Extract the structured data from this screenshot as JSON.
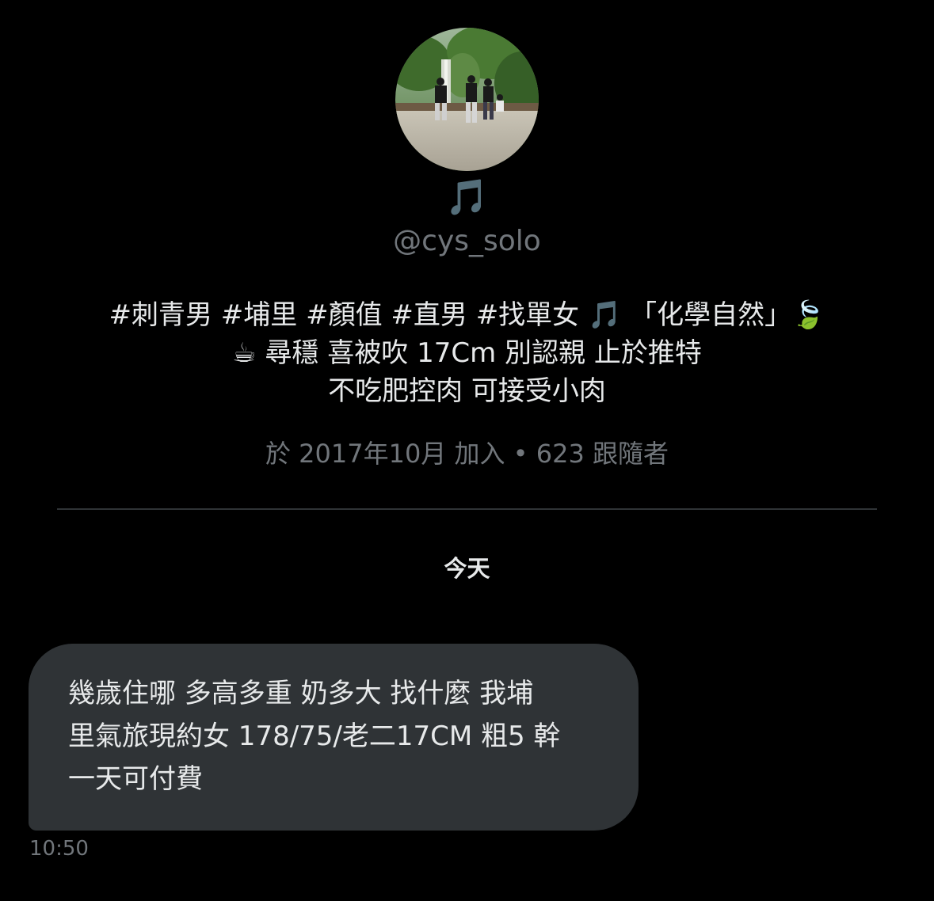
{
  "profile": {
    "display_name": "🎵",
    "handle": "@cys_solo",
    "bio_lines": [
      "#刺青男 #埔里 #顏值 #直男 #找單女 🎵 「化學自然」🍃",
      "☕ 尋穩 喜被吹 17Cm 別認親 止於推特",
      "不吃肥控肉 可接受小肉"
    ],
    "meta": "於 2017年10月 加入 • 623 跟隨者"
  },
  "conversation": {
    "date_separator": "今天",
    "messages": [
      {
        "lines": [
          "幾歲住哪 多高多重 奶多大 找什麼 我埔",
          "里氣旅現約女 178/75/老二17CM 粗5 幹",
          "一天可付費"
        ],
        "time": "10:50"
      }
    ]
  },
  "colors": {
    "background": "#000000",
    "primary_text": "#e7e9ea",
    "secondary_text": "#71767b",
    "bubble": "#2f3336",
    "divider": "#2f3336"
  }
}
